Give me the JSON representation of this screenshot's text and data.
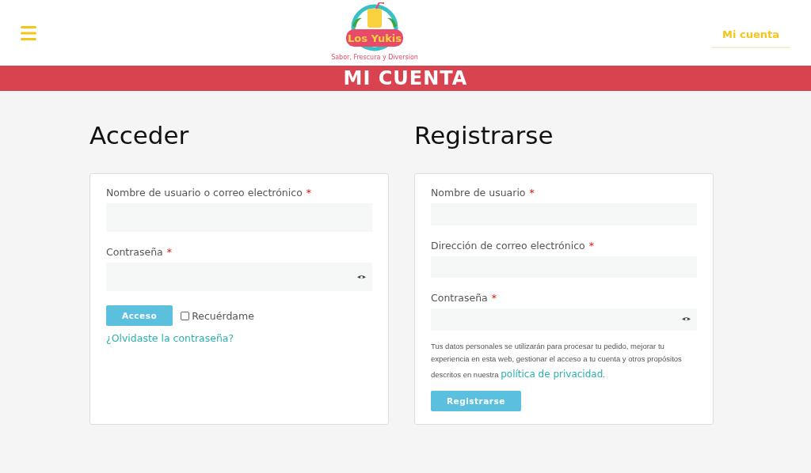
{
  "header": {
    "logo": {
      "name": "Los Yukis",
      "tagline": "Sabor, Frescura y Diversion"
    },
    "account_link": "Mi cuenta"
  },
  "banner": {
    "title": "MI CUENTA"
  },
  "login": {
    "title": "Acceder",
    "fields": [
      {
        "label": "Nombre de usuario o correo electrónico",
        "required_mark": "*",
        "kind": "text"
      },
      {
        "label": "Contraseña",
        "required_mark": "*",
        "kind": "password"
      }
    ],
    "button": "Acceso",
    "remember": {
      "label": "Recuérdame",
      "checked": false
    },
    "forgot_link": "¿Olvidaste la contraseña?"
  },
  "register": {
    "title": "Registrarse",
    "fields": [
      {
        "label": "Nombre de usuario",
        "required_mark": "*",
        "kind": "text"
      },
      {
        "label": "Dirección de correo electrónico",
        "required_mark": "*",
        "kind": "text"
      },
      {
        "label": "Contraseña",
        "required_mark": "*",
        "kind": "password"
      }
    ],
    "note": {
      "text": "Tus datos personales se utilizarán para procesar tu pedido, mejorar tu experiencia en esta web, gestionar el acceso a tu cuenta y otros propósitos descritos en nuestra",
      "link": "política de privacidad",
      "after": "."
    },
    "button": "Registrarse"
  }
}
